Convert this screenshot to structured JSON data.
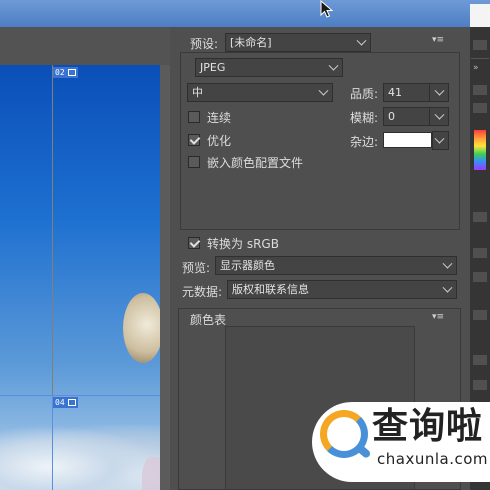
{
  "preview": {
    "slices": [
      "02",
      "04"
    ]
  },
  "settings": {
    "preset_label": "预设:",
    "preset_value": "[未命名]",
    "format_value": "JPEG",
    "quality_level_value": "中",
    "quality_label": "品质:",
    "quality_value": "41",
    "blur_label": "模糊:",
    "blur_value": "0",
    "matte_label": "杂边:",
    "matte_color": "#ffffff",
    "progressive_label": "连续",
    "progressive_checked": false,
    "optimized_label": "优化",
    "optimized_checked": true,
    "embed_profile_label": "嵌入颜色配置文件",
    "embed_profile_checked": false,
    "convert_srgb_label": "转换为 sRGB",
    "convert_srgb_checked": true,
    "preview_label": "预览:",
    "preview_value": "显示器颜色",
    "metadata_label": "元数据:",
    "metadata_value": "版权和联系信息",
    "color_table_label": "颜色表"
  },
  "icons": {
    "panel_menu": "panel-menu-icon",
    "cursor": "mouse-cursor-icon",
    "slice_icon": "slice-image-icon"
  },
  "watermark": {
    "brand": "查询啦",
    "url": "chaxunla.com"
  },
  "colors": {
    "panel_bg": "#4f4f4f",
    "field_bg": "#444444",
    "slice_accent": "#3b73d0",
    "watermark_orange": "#f5a623",
    "watermark_blue": "#4a90d9"
  }
}
